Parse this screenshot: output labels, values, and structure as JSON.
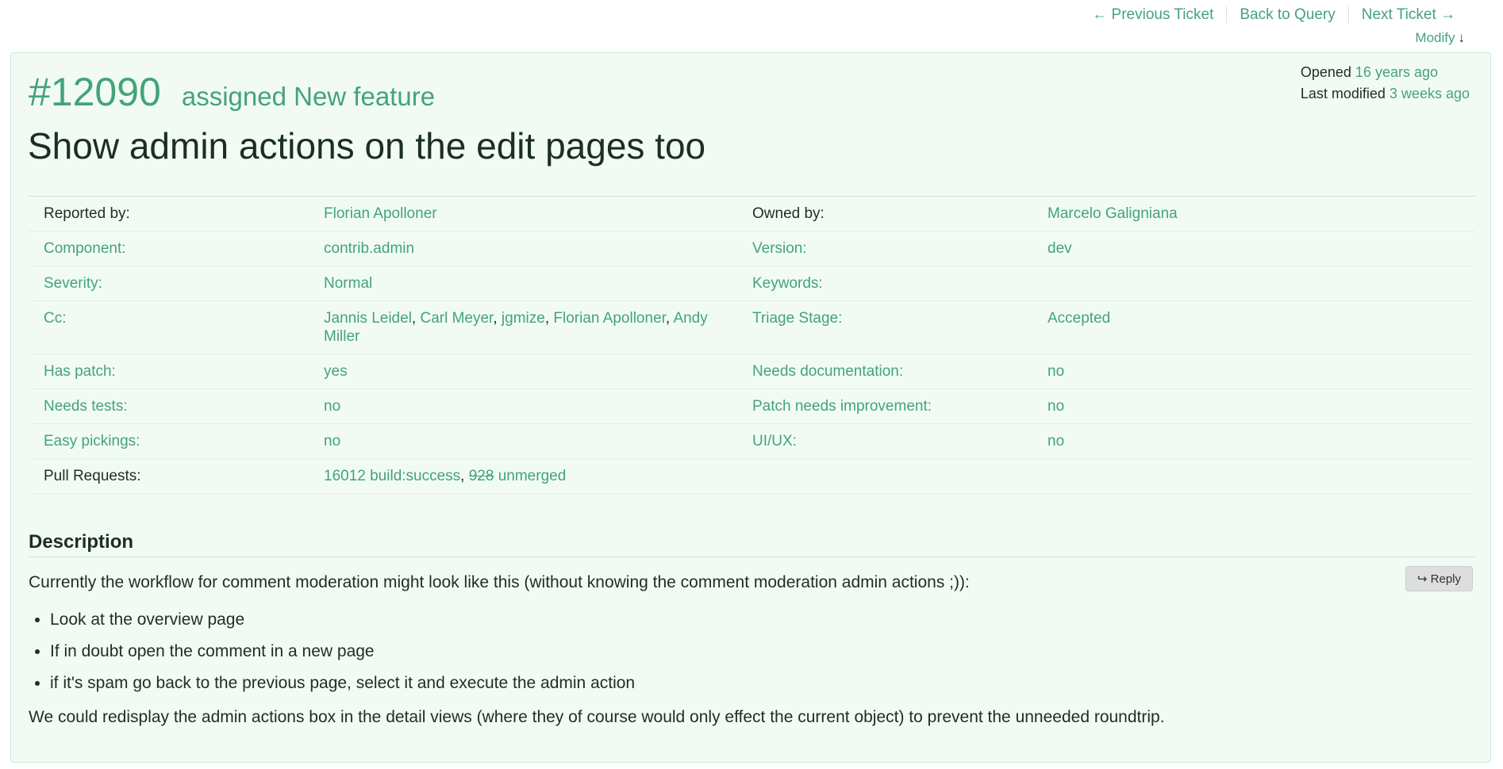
{
  "nav": {
    "previous": "← Previous Ticket",
    "back": "Back to Query",
    "next": "Next Ticket →",
    "modify": "Modify",
    "modify_arrow": "↓"
  },
  "ticket": {
    "id": "#12090",
    "status": "assigned New feature",
    "summary": "Show admin actions on the edit pages too",
    "opened_label": "Opened",
    "opened_value": "16 years ago",
    "modified_label": "Last modified",
    "modified_value": "3 weeks ago"
  },
  "props": {
    "reported_by": {
      "label": "Reported by:",
      "value": "Florian Apolloner"
    },
    "owned_by": {
      "label": "Owned by:",
      "value": "Marcelo Galigniana"
    },
    "component": {
      "label": "Component:",
      "value": "contrib.admin"
    },
    "version": {
      "label": "Version:",
      "value": "dev"
    },
    "severity": {
      "label": "Severity:",
      "value": "Normal"
    },
    "keywords": {
      "label": "Keywords:",
      "value": ""
    },
    "cc": {
      "label": "Cc:",
      "people": [
        "Jannis Leidel",
        "Carl Meyer",
        "jgmize",
        "Florian Apolloner",
        "Andy Miller"
      ]
    },
    "triage": {
      "label": "Triage Stage:",
      "value": "Accepted"
    },
    "has_patch": {
      "label": "Has patch:",
      "value": "yes"
    },
    "needs_docs": {
      "label": "Needs documentation:",
      "value": "no"
    },
    "needs_tests": {
      "label": "Needs tests:",
      "value": "no"
    },
    "patch_improve": {
      "label": "Patch needs improvement:",
      "value": "no"
    },
    "easy": {
      "label": "Easy pickings:",
      "value": "no"
    },
    "uiux": {
      "label": "UI/UX:",
      "value": "no"
    },
    "pull_requests": {
      "label": "Pull Requests:",
      "pr1": "16012 build:success",
      "pr2_num": "928",
      "pr2_status": "unmerged"
    }
  },
  "description": {
    "title": "Description",
    "reply_label": "↪ Reply",
    "intro": "Currently the workflow for comment moderation might look like this (without knowing the comment moderation admin actions ;)):",
    "items": [
      "Look at the overview page",
      "If in doubt open the comment in a new page",
      "if it's spam go back to the previous page, select it and execute the admin action"
    ],
    "outro": "We could redisplay the admin actions box in the detail views (where they of course would only effect the current object) to prevent the unneeded roundtrip."
  }
}
